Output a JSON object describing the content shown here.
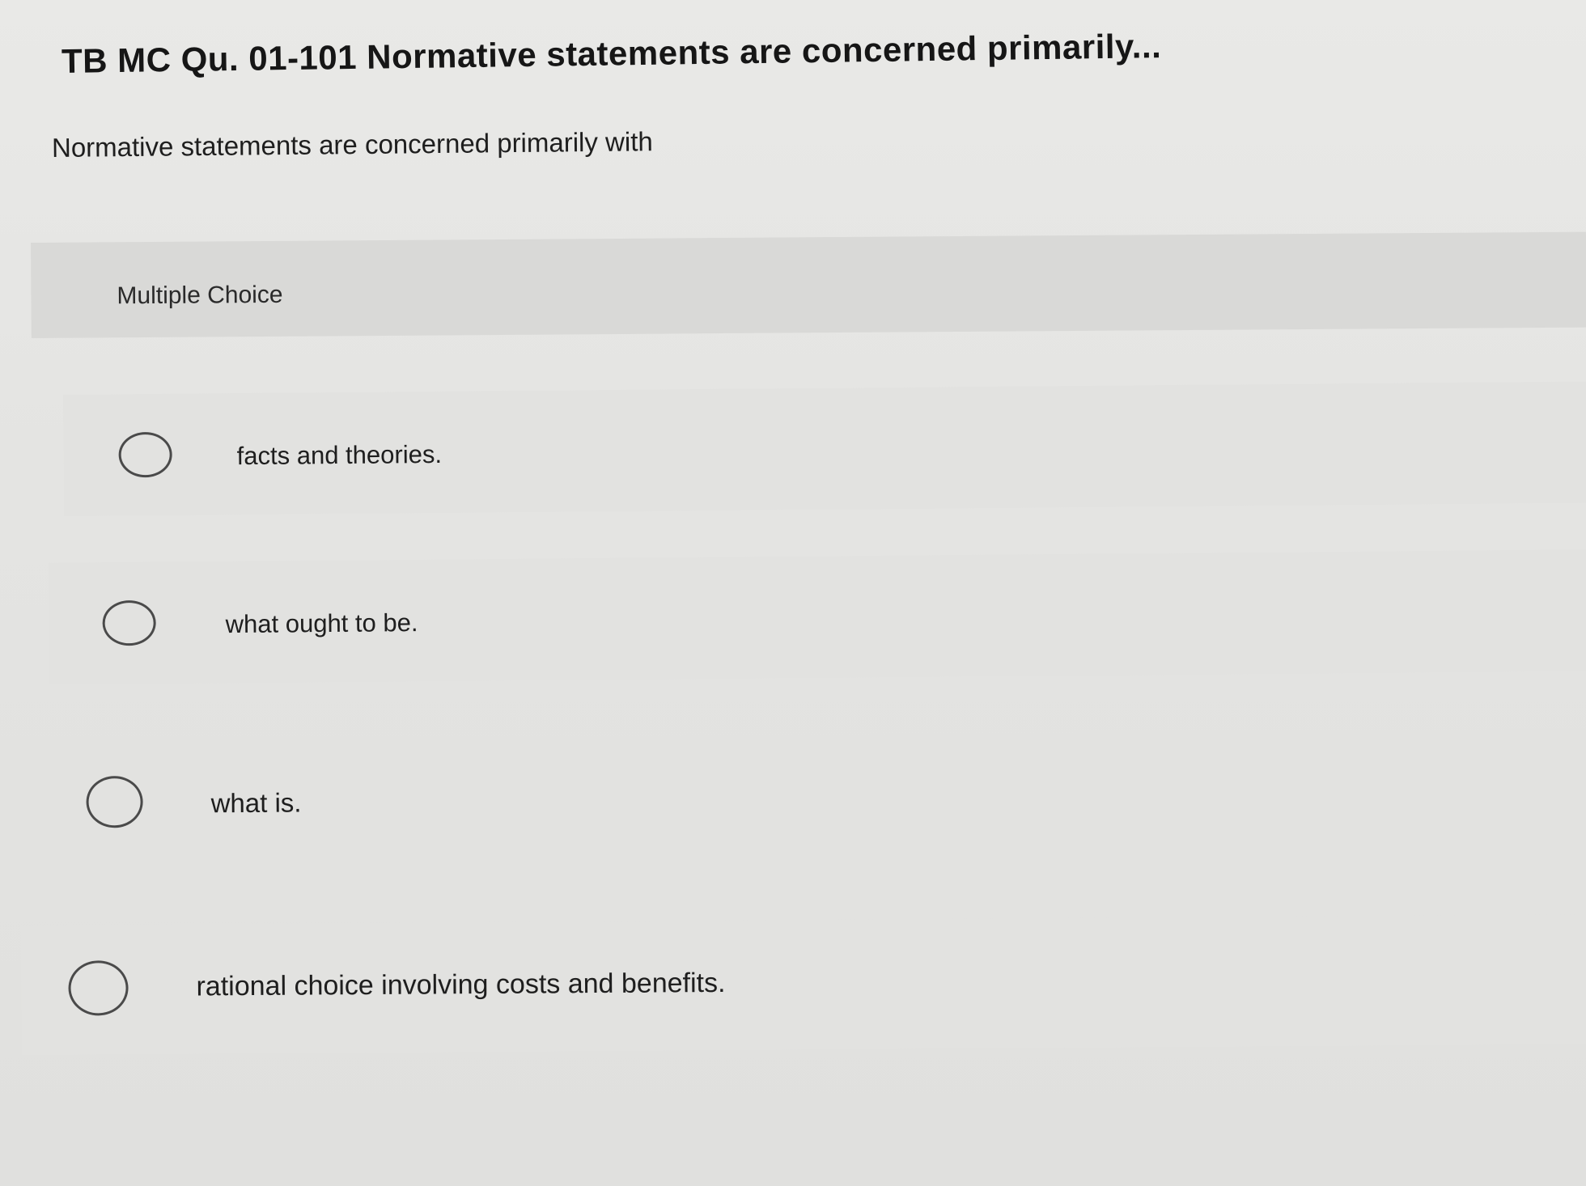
{
  "question": {
    "title": "TB MC Qu. 01-101 Normative statements are concerned primarily...",
    "prompt": "Normative statements are concerned primarily with"
  },
  "multiple_choice": {
    "header_label": "Multiple Choice",
    "options": [
      {
        "label": "facts and theories.",
        "selected": false
      },
      {
        "label": "what ought to be.",
        "selected": false
      },
      {
        "label": "what is.",
        "selected": false
      },
      {
        "label": "rational choice involving costs and benefits.",
        "selected": false
      }
    ]
  },
  "colors": {
    "background": "#e6e6e4",
    "header_band": "#d9d9d7",
    "option_row": "#e2e2e0",
    "text": "#1c1c1c",
    "radio_border": "#4a4a4a"
  }
}
